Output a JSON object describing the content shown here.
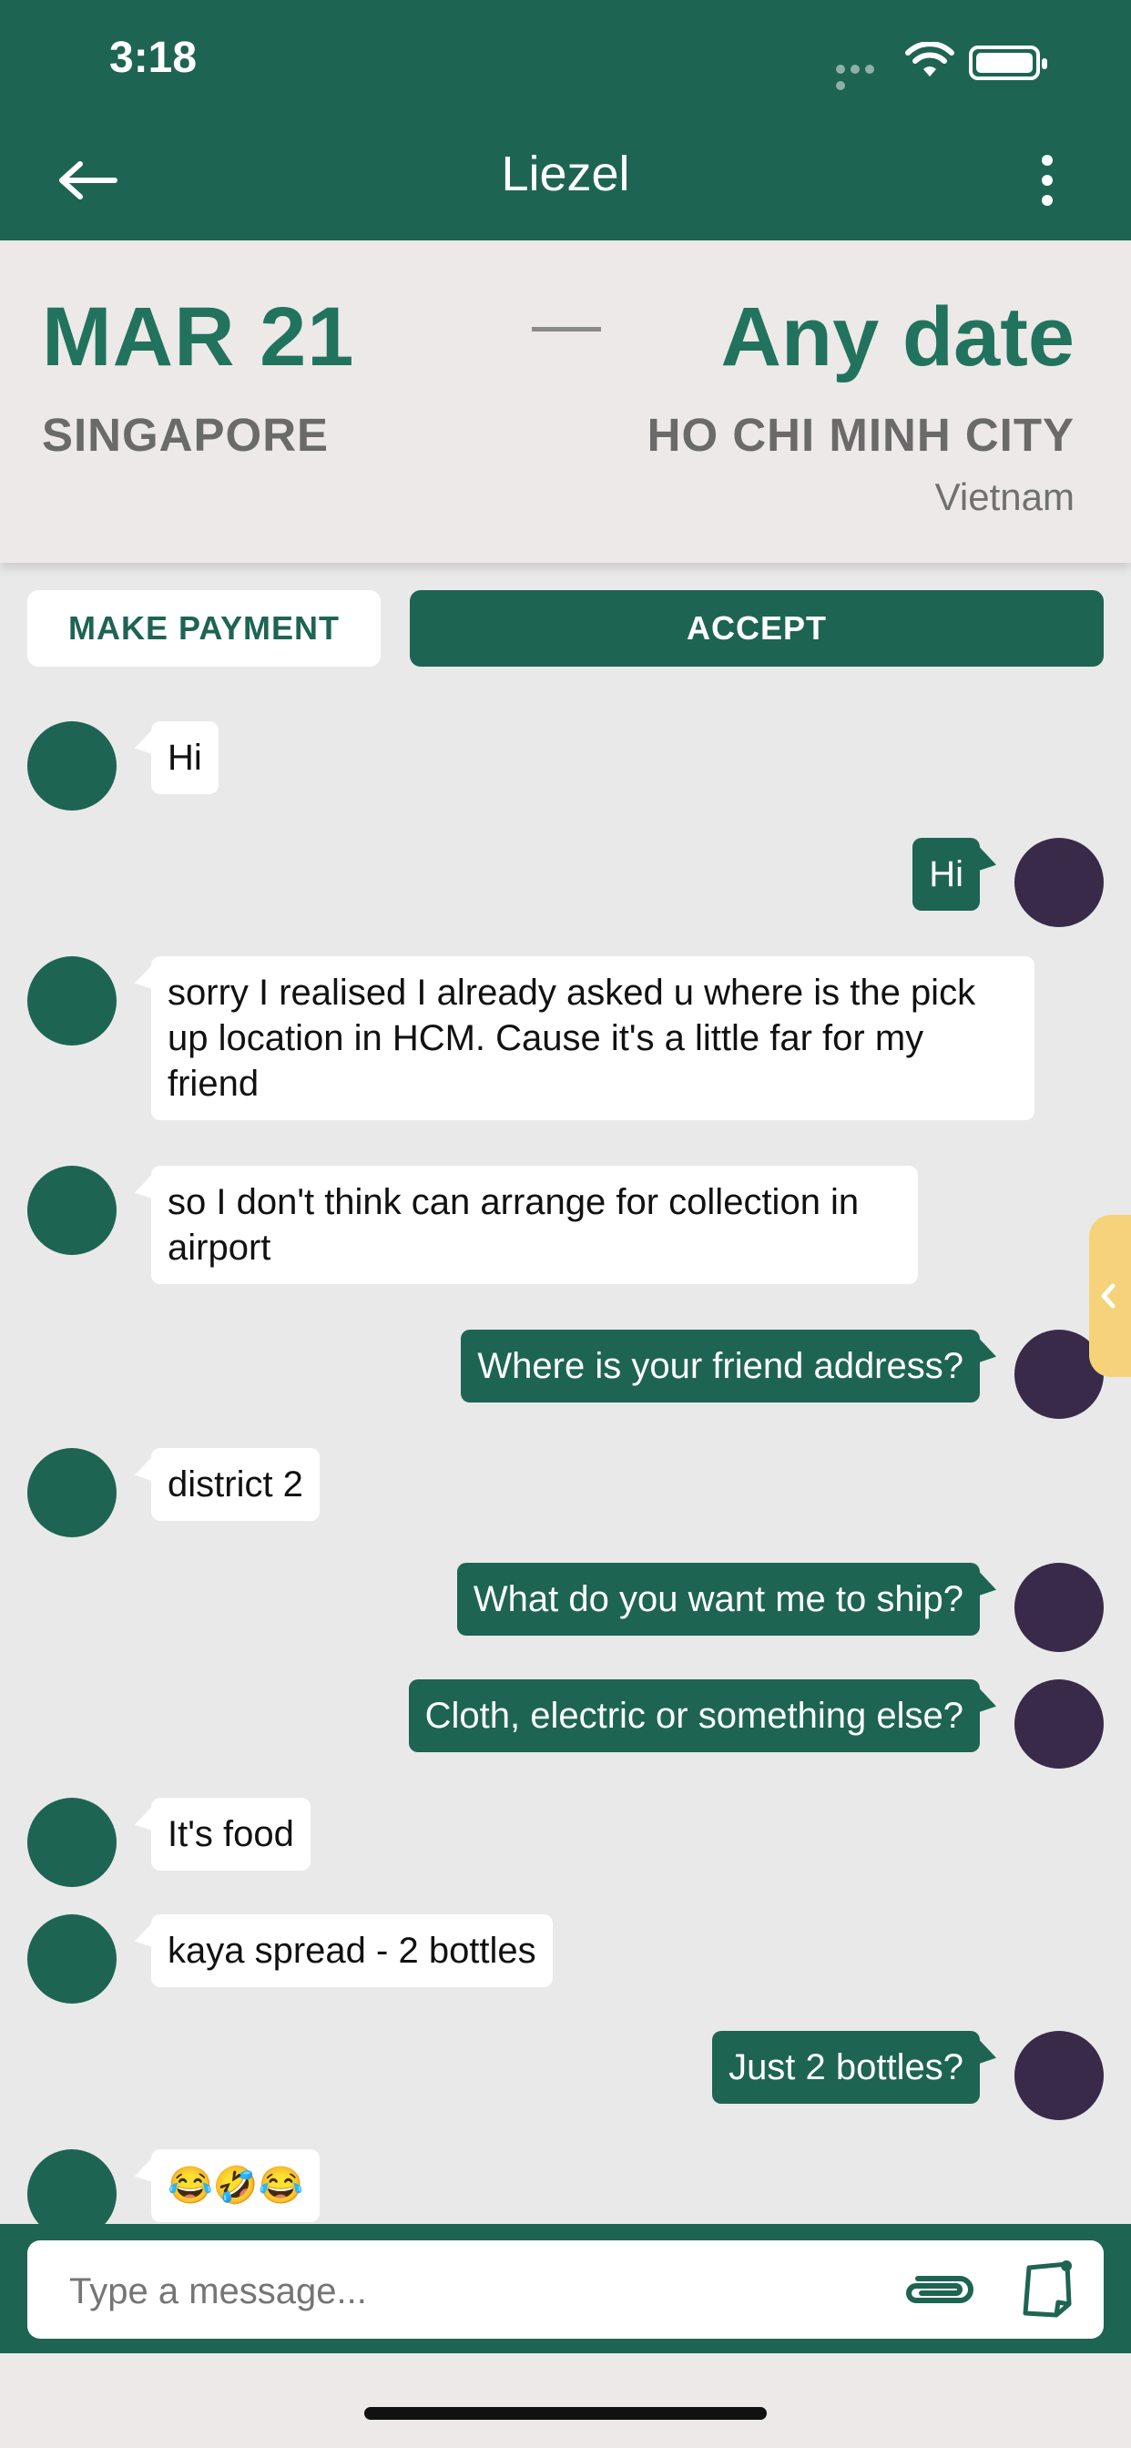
{
  "status_bar": {
    "time": "3:18"
  },
  "header": {
    "title": "Liezel"
  },
  "trip": {
    "from_date": "MAR 21",
    "to_date": "Any date",
    "from_city": "SINGAPORE",
    "to_city": "HO CHI MINH CITY",
    "to_country": "Vietnam"
  },
  "actions": {
    "make_payment": "MAKE PAYMENT",
    "accept": "ACCEPT"
  },
  "messages": [
    {
      "from": "them",
      "text": "Hi"
    },
    {
      "from": "me",
      "text": "Hi"
    },
    {
      "from": "them",
      "text": "sorry I realised I already asked u where is the pick up location in HCM. Cause it's a little far for my friend"
    },
    {
      "from": "them",
      "text": "so I don't think can arrange for collection in airport"
    },
    {
      "from": "me",
      "text": "Where is your friend address?"
    },
    {
      "from": "them",
      "text": "district 2"
    },
    {
      "from": "me",
      "text": "What do you want me to ship?"
    },
    {
      "from": "me",
      "text": "Cloth, electric or something else?"
    },
    {
      "from": "them",
      "text": "It's food"
    },
    {
      "from": "them",
      "text": "kaya spread - 2 bottles"
    },
    {
      "from": "me",
      "text": "Just 2 bottles?"
    },
    {
      "from": "them",
      "text": "😂🤣😂"
    }
  ],
  "composer": {
    "placeholder": "Type a message..."
  },
  "colors": {
    "primary": "#1e6453",
    "accent": "#22735e",
    "tab": "#f6d27a"
  },
  "icons": [
    "back-arrow-icon",
    "more-vertical-icon",
    "wifi-icon",
    "battery-icon",
    "paperclip-icon",
    "note-icon",
    "chevron-left-icon"
  ]
}
